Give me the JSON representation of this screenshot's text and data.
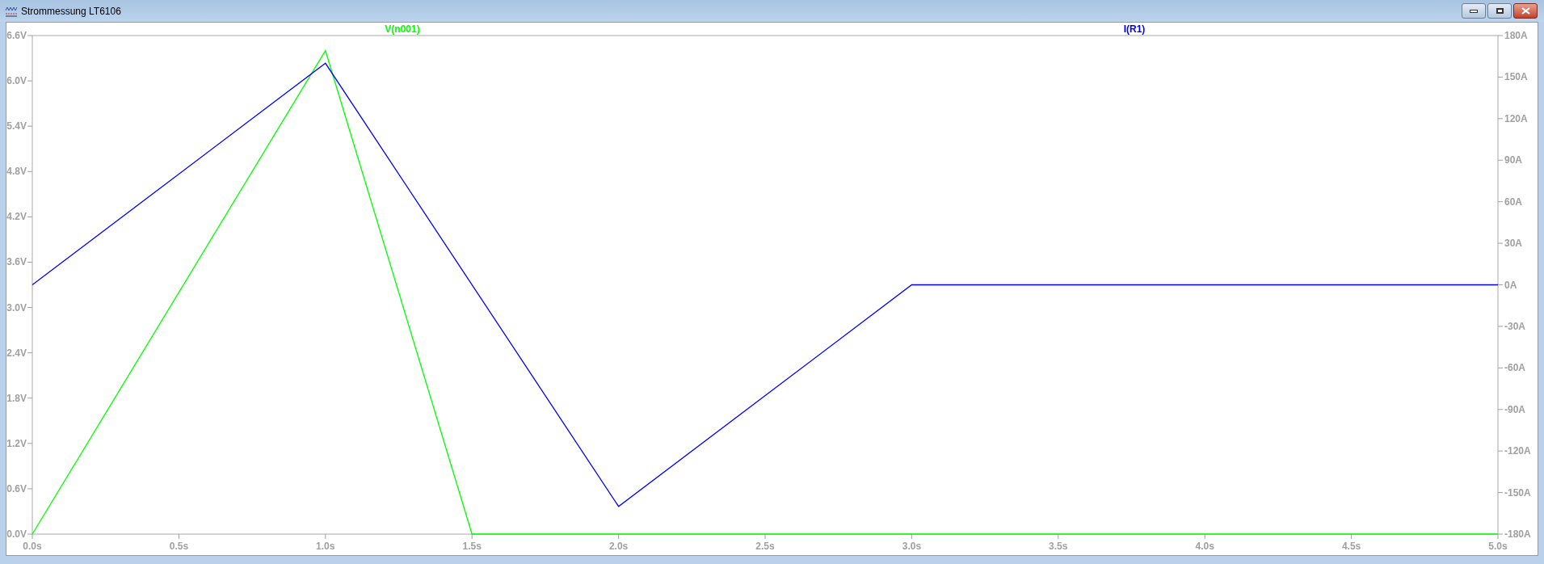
{
  "window": {
    "title": "Strommessung LT6106"
  },
  "plot": {
    "chart_data": {
      "type": "line",
      "x": [
        0,
        1,
        1.5,
        2,
        3,
        5
      ],
      "xlim": [
        0,
        5
      ],
      "xticks": [
        {
          "value": 0,
          "label": "0.0s"
        },
        {
          "value": 0.5,
          "label": "0.5s"
        },
        {
          "value": 1,
          "label": "1.0s"
        },
        {
          "value": 1.5,
          "label": "1.5s"
        },
        {
          "value": 2,
          "label": "2.0s"
        },
        {
          "value": 2.5,
          "label": "2.5s"
        },
        {
          "value": 3,
          "label": "3.0s"
        },
        {
          "value": 3.5,
          "label": "3.5s"
        },
        {
          "value": 4,
          "label": "4.0s"
        },
        {
          "value": 4.5,
          "label": "4.5s"
        },
        {
          "value": 5,
          "label": "5.0s"
        }
      ],
      "ylim": [
        0,
        6.6
      ],
      "yticks": [
        {
          "value": 0,
          "label": "0.0V"
        },
        {
          "value": 0.6,
          "label": "0.6V"
        },
        {
          "value": 1.2,
          "label": "1.2V"
        },
        {
          "value": 1.8,
          "label": "1.8V"
        },
        {
          "value": 2.4,
          "label": "2.4V"
        },
        {
          "value": 3,
          "label": "3.0V"
        },
        {
          "value": 3.6,
          "label": "3.6V"
        },
        {
          "value": 4.2,
          "label": "4.2V"
        },
        {
          "value": 4.8,
          "label": "4.8V"
        },
        {
          "value": 5.4,
          "label": "5.4V"
        },
        {
          "value": 6,
          "label": "6.0V"
        },
        {
          "value": 6.6,
          "label": "6.6V"
        }
      ],
      "y2lim": [
        -180,
        180
      ],
      "y2ticks": [
        {
          "value": -180,
          "label": "-180A"
        },
        {
          "value": -150,
          "label": "-150A"
        },
        {
          "value": -120,
          "label": "-120A"
        },
        {
          "value": -90,
          "label": "-90A"
        },
        {
          "value": -60,
          "label": "-60A"
        },
        {
          "value": -30,
          "label": "-30A"
        },
        {
          "value": 0,
          "label": "0A"
        },
        {
          "value": 30,
          "label": "30A"
        },
        {
          "value": 60,
          "label": "60A"
        },
        {
          "value": 90,
          "label": "90A"
        },
        {
          "value": 120,
          "label": "120A"
        },
        {
          "value": 150,
          "label": "150A"
        },
        {
          "value": 180,
          "label": "180A"
        }
      ],
      "series": [
        {
          "name": "V(n001)",
          "color": "#00ff00",
          "values": [
            0,
            6.4,
            0,
            0,
            0,
            0
          ]
        },
        {
          "name": "I(R1)",
          "color": "#0000ff",
          "axis": "y2",
          "values": [
            0,
            160,
            null,
            -160,
            0,
            0
          ]
        }
      ]
    }
  }
}
